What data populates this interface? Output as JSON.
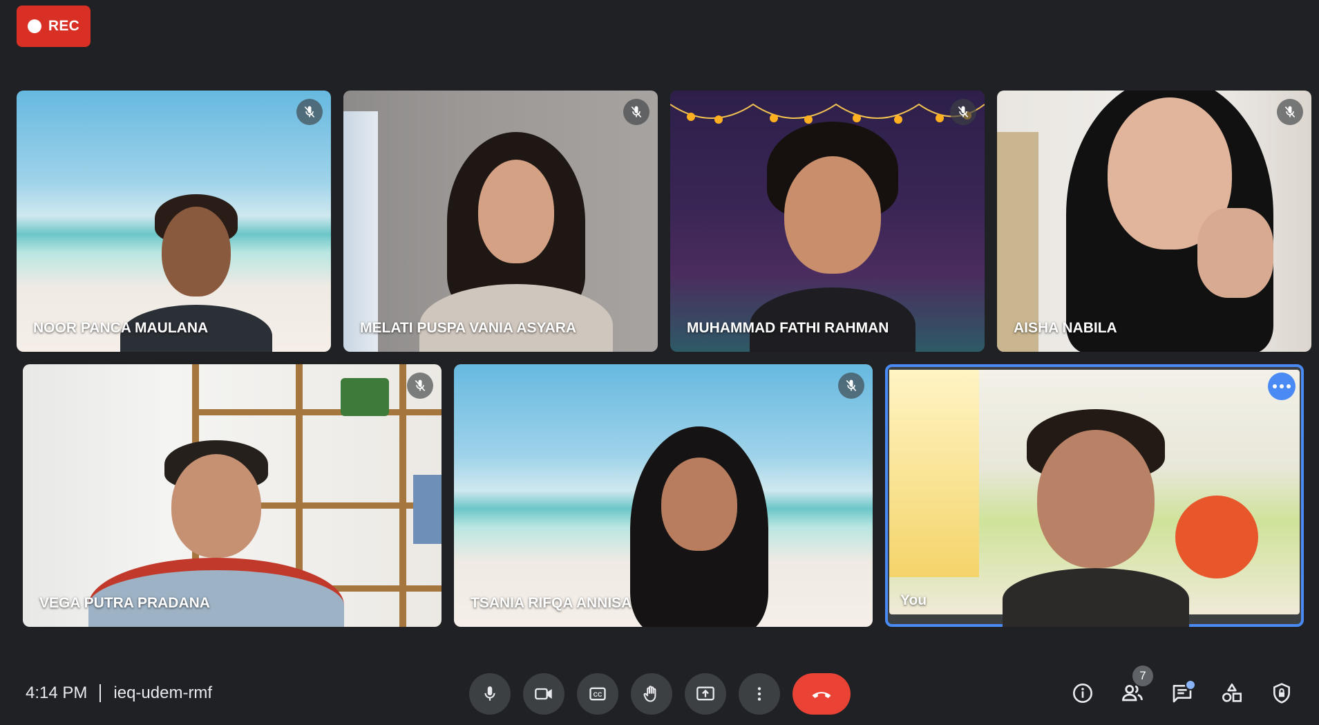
{
  "recording": {
    "label": "REC"
  },
  "participants": [
    {
      "name": "NOOR PANCA MAULANA"
    },
    {
      "name": "MELATI PUSPA VANIA ASYARA"
    },
    {
      "name": "MUHAMMAD FATHI RAHMAN"
    },
    {
      "name": "AISHA NABILA"
    },
    {
      "name": "VEGA PUTRA PRADANA"
    },
    {
      "name": "TSANIA RIFQA ANNISA"
    },
    {
      "name": "You"
    }
  ],
  "meeting": {
    "time": "4:14 PM",
    "code": "ieq-udem-rmf"
  },
  "people_count": "7",
  "colors": {
    "accent": "#4a8af4",
    "end_call": "#ea4335",
    "rec": "#d93025"
  }
}
